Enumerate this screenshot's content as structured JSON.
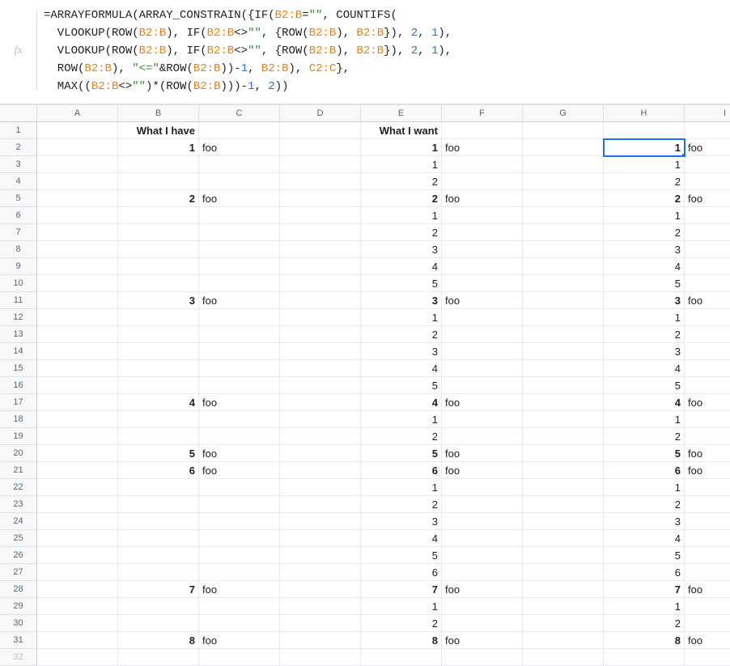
{
  "formula_bar": {
    "fx_label": "fx",
    "tokens": [
      [
        {
          "c": "plain",
          "t": "=ARRAYFORMULA(ARRAY_CONSTRAIN({IF("
        },
        {
          "c": "ref",
          "t": "B2:B"
        },
        {
          "c": "plain",
          "t": "="
        },
        {
          "c": "str",
          "t": "\"\""
        },
        {
          "c": "plain",
          "t": ", COUNTIFS("
        }
      ],
      [
        {
          "c": "plain",
          "t": "  VLOOKUP(ROW("
        },
        {
          "c": "ref",
          "t": "B2:B"
        },
        {
          "c": "plain",
          "t": "), IF("
        },
        {
          "c": "ref",
          "t": "B2:B"
        },
        {
          "c": "plain",
          "t": "<>"
        },
        {
          "c": "str",
          "t": "\"\""
        },
        {
          "c": "plain",
          "t": ", {ROW("
        },
        {
          "c": "ref",
          "t": "B2:B"
        },
        {
          "c": "plain",
          "t": "), "
        },
        {
          "c": "ref",
          "t": "B2:B"
        },
        {
          "c": "plain",
          "t": "}), "
        },
        {
          "c": "num",
          "t": "2"
        },
        {
          "c": "plain",
          "t": ", "
        },
        {
          "c": "num",
          "t": "1"
        },
        {
          "c": "plain",
          "t": "),"
        }
      ],
      [
        {
          "c": "plain",
          "t": "  VLOOKUP(ROW("
        },
        {
          "c": "ref",
          "t": "B2:B"
        },
        {
          "c": "plain",
          "t": "), IF("
        },
        {
          "c": "ref",
          "t": "B2:B"
        },
        {
          "c": "plain",
          "t": "<>"
        },
        {
          "c": "str",
          "t": "\"\""
        },
        {
          "c": "plain",
          "t": ", {ROW("
        },
        {
          "c": "ref",
          "t": "B2:B"
        },
        {
          "c": "plain",
          "t": "), "
        },
        {
          "c": "ref",
          "t": "B2:B"
        },
        {
          "c": "plain",
          "t": "}), "
        },
        {
          "c": "num",
          "t": "2"
        },
        {
          "c": "plain",
          "t": ", "
        },
        {
          "c": "num",
          "t": "1"
        },
        {
          "c": "plain",
          "t": "),"
        }
      ],
      [
        {
          "c": "plain",
          "t": "  ROW("
        },
        {
          "c": "ref",
          "t": "B2:B"
        },
        {
          "c": "plain",
          "t": "), "
        },
        {
          "c": "str",
          "t": "\"<=\""
        },
        {
          "c": "plain",
          "t": "&ROW("
        },
        {
          "c": "ref",
          "t": "B2:B"
        },
        {
          "c": "plain",
          "t": "))-"
        },
        {
          "c": "num",
          "t": "1"
        },
        {
          "c": "plain",
          "t": ", "
        },
        {
          "c": "ref",
          "t": "B2:B"
        },
        {
          "c": "plain",
          "t": "), "
        },
        {
          "c": "ref",
          "t": "C2:C"
        },
        {
          "c": "plain",
          "t": "},"
        }
      ],
      [
        {
          "c": "plain",
          "t": "  MAX(("
        },
        {
          "c": "ref",
          "t": "B2:B"
        },
        {
          "c": "plain",
          "t": "<>"
        },
        {
          "c": "str",
          "t": "\"\""
        },
        {
          "c": "plain",
          "t": ")*(ROW("
        },
        {
          "c": "ref",
          "t": "B2:B"
        },
        {
          "c": "plain",
          "t": ")))-"
        },
        {
          "c": "num",
          "t": "1"
        },
        {
          "c": "plain",
          "t": ", "
        },
        {
          "c": "num",
          "t": "2"
        },
        {
          "c": "plain",
          "t": "))"
        }
      ]
    ]
  },
  "columns": [
    "A",
    "B",
    "C",
    "D",
    "E",
    "F",
    "G",
    "H",
    "I"
  ],
  "visible_rows": 31,
  "active_cell": {
    "row": 2,
    "col": "H"
  },
  "cells": {
    "r1": {
      "B": {
        "v": "What I have",
        "a": "right",
        "b": true
      },
      "E": {
        "v": "What I want",
        "a": "right",
        "b": true
      }
    },
    "r2": {
      "B": {
        "v": "1",
        "a": "right",
        "b": true
      },
      "C": {
        "v": "foo",
        "a": "left"
      },
      "E": {
        "v": "1",
        "a": "right",
        "b": true
      },
      "F": {
        "v": "foo",
        "a": "left"
      },
      "H": {
        "v": "1",
        "a": "right",
        "b": true
      },
      "I": {
        "v": "foo",
        "a": "left"
      }
    },
    "r3": {
      "E": {
        "v": "1",
        "a": "right"
      },
      "H": {
        "v": "1",
        "a": "right"
      }
    },
    "r4": {
      "E": {
        "v": "2",
        "a": "right"
      },
      "H": {
        "v": "2",
        "a": "right"
      }
    },
    "r5": {
      "B": {
        "v": "2",
        "a": "right",
        "b": true
      },
      "C": {
        "v": "foo",
        "a": "left"
      },
      "E": {
        "v": "2",
        "a": "right",
        "b": true
      },
      "F": {
        "v": "foo",
        "a": "left"
      },
      "H": {
        "v": "2",
        "a": "right",
        "b": true
      },
      "I": {
        "v": "foo",
        "a": "left"
      }
    },
    "r6": {
      "E": {
        "v": "1",
        "a": "right"
      },
      "H": {
        "v": "1",
        "a": "right"
      }
    },
    "r7": {
      "E": {
        "v": "2",
        "a": "right"
      },
      "H": {
        "v": "2",
        "a": "right"
      }
    },
    "r8": {
      "E": {
        "v": "3",
        "a": "right"
      },
      "H": {
        "v": "3",
        "a": "right"
      }
    },
    "r9": {
      "E": {
        "v": "4",
        "a": "right"
      },
      "H": {
        "v": "4",
        "a": "right"
      }
    },
    "r10": {
      "E": {
        "v": "5",
        "a": "right"
      },
      "H": {
        "v": "5",
        "a": "right"
      }
    },
    "r11": {
      "B": {
        "v": "3",
        "a": "right",
        "b": true
      },
      "C": {
        "v": "foo",
        "a": "left"
      },
      "E": {
        "v": "3",
        "a": "right",
        "b": true
      },
      "F": {
        "v": "foo",
        "a": "left"
      },
      "H": {
        "v": "3",
        "a": "right",
        "b": true
      },
      "I": {
        "v": "foo",
        "a": "left"
      }
    },
    "r12": {
      "E": {
        "v": "1",
        "a": "right"
      },
      "H": {
        "v": "1",
        "a": "right"
      }
    },
    "r13": {
      "E": {
        "v": "2",
        "a": "right"
      },
      "H": {
        "v": "2",
        "a": "right"
      }
    },
    "r14": {
      "E": {
        "v": "3",
        "a": "right"
      },
      "H": {
        "v": "3",
        "a": "right"
      }
    },
    "r15": {
      "E": {
        "v": "4",
        "a": "right"
      },
      "H": {
        "v": "4",
        "a": "right"
      }
    },
    "r16": {
      "E": {
        "v": "5",
        "a": "right"
      },
      "H": {
        "v": "5",
        "a": "right"
      }
    },
    "r17": {
      "B": {
        "v": "4",
        "a": "right",
        "b": true
      },
      "C": {
        "v": "foo",
        "a": "left"
      },
      "E": {
        "v": "4",
        "a": "right",
        "b": true
      },
      "F": {
        "v": "foo",
        "a": "left"
      },
      "H": {
        "v": "4",
        "a": "right",
        "b": true
      },
      "I": {
        "v": "foo",
        "a": "left"
      }
    },
    "r18": {
      "E": {
        "v": "1",
        "a": "right"
      },
      "H": {
        "v": "1",
        "a": "right"
      }
    },
    "r19": {
      "E": {
        "v": "2",
        "a": "right"
      },
      "H": {
        "v": "2",
        "a": "right"
      }
    },
    "r20": {
      "B": {
        "v": "5",
        "a": "right",
        "b": true
      },
      "C": {
        "v": "foo",
        "a": "left"
      },
      "E": {
        "v": "5",
        "a": "right",
        "b": true
      },
      "F": {
        "v": "foo",
        "a": "left"
      },
      "H": {
        "v": "5",
        "a": "right",
        "b": true
      },
      "I": {
        "v": "foo",
        "a": "left"
      }
    },
    "r21": {
      "B": {
        "v": "6",
        "a": "right",
        "b": true
      },
      "C": {
        "v": "foo",
        "a": "left"
      },
      "E": {
        "v": "6",
        "a": "right",
        "b": true
      },
      "F": {
        "v": "foo",
        "a": "left"
      },
      "H": {
        "v": "6",
        "a": "right",
        "b": true
      },
      "I": {
        "v": "foo",
        "a": "left"
      }
    },
    "r22": {
      "E": {
        "v": "1",
        "a": "right"
      },
      "H": {
        "v": "1",
        "a": "right"
      }
    },
    "r23": {
      "E": {
        "v": "2",
        "a": "right"
      },
      "H": {
        "v": "2",
        "a": "right"
      }
    },
    "r24": {
      "E": {
        "v": "3",
        "a": "right"
      },
      "H": {
        "v": "3",
        "a": "right"
      }
    },
    "r25": {
      "E": {
        "v": "4",
        "a": "right"
      },
      "H": {
        "v": "4",
        "a": "right"
      }
    },
    "r26": {
      "E": {
        "v": "5",
        "a": "right"
      },
      "H": {
        "v": "5",
        "a": "right"
      }
    },
    "r27": {
      "E": {
        "v": "6",
        "a": "right"
      },
      "H": {
        "v": "6",
        "a": "right"
      }
    },
    "r28": {
      "B": {
        "v": "7",
        "a": "right",
        "b": true
      },
      "C": {
        "v": "foo",
        "a": "left"
      },
      "E": {
        "v": "7",
        "a": "right",
        "b": true
      },
      "F": {
        "v": "foo",
        "a": "left"
      },
      "H": {
        "v": "7",
        "a": "right",
        "b": true
      },
      "I": {
        "v": "foo",
        "a": "left"
      }
    },
    "r29": {
      "E": {
        "v": "1",
        "a": "right"
      },
      "H": {
        "v": "1",
        "a": "right"
      }
    },
    "r30": {
      "E": {
        "v": "2",
        "a": "right"
      },
      "H": {
        "v": "2",
        "a": "right"
      }
    },
    "r31": {
      "B": {
        "v": "8",
        "a": "right",
        "b": true
      },
      "C": {
        "v": "foo",
        "a": "left"
      },
      "E": {
        "v": "8",
        "a": "right",
        "b": true
      },
      "F": {
        "v": "foo",
        "a": "left"
      },
      "H": {
        "v": "8",
        "a": "right",
        "b": true
      },
      "I": {
        "v": "foo",
        "a": "left"
      }
    }
  }
}
